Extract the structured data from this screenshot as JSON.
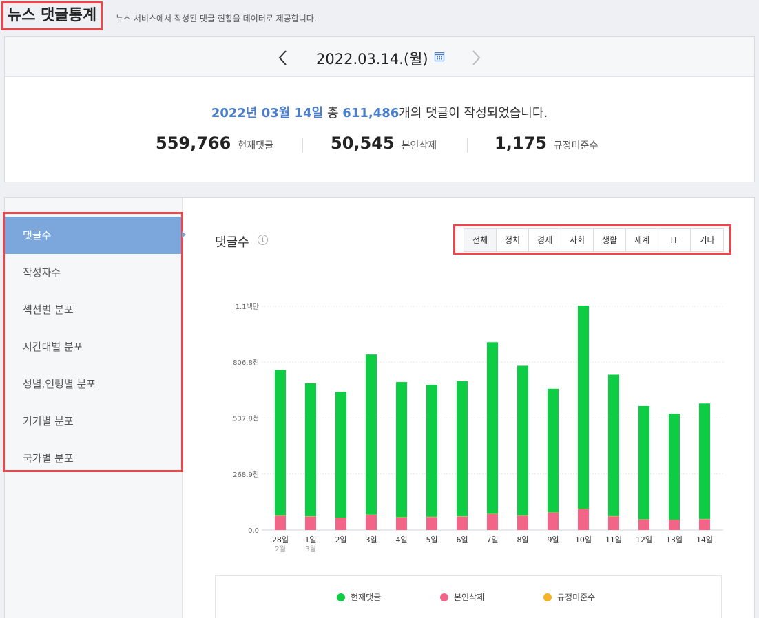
{
  "header": {
    "title": "뉴스 댓글통계",
    "description": "뉴스 서비스에서 작성된 댓글 현황을 데이터로 제공합니다."
  },
  "date_bar": {
    "date": "2022.03.14.(월)",
    "prev_icon": "chevron-left-icon",
    "next_icon": "chevron-right-icon",
    "calendar_icon": "calendar-icon"
  },
  "summary": {
    "date_text": "2022년 03월 14일",
    "total_prefix": "총",
    "total_count": "611,486",
    "suffix": "개의 댓글이 작성되었습니다.",
    "stats": [
      {
        "value": "559,766",
        "label": "현재댓글"
      },
      {
        "value": "50,545",
        "label": "본인삭제"
      },
      {
        "value": "1,175",
        "label": "규정미준수"
      }
    ]
  },
  "sidebar": {
    "items": [
      {
        "label": "댓글수",
        "active": true
      },
      {
        "label": "작성자수",
        "active": false
      },
      {
        "label": "섹션별 분포",
        "active": false
      },
      {
        "label": "시간대별 분포",
        "active": false
      },
      {
        "label": "성별,연령별 분포",
        "active": false
      },
      {
        "label": "기기별 분포",
        "active": false
      },
      {
        "label": "국가별 분포",
        "active": false
      }
    ]
  },
  "chart_panel": {
    "title": "댓글수",
    "info_icon": "info-icon",
    "tabs": [
      {
        "label": "전체",
        "active": true
      },
      {
        "label": "정치",
        "active": false
      },
      {
        "label": "경제",
        "active": false
      },
      {
        "label": "사회",
        "active": false
      },
      {
        "label": "생활",
        "active": false
      },
      {
        "label": "세계",
        "active": false
      },
      {
        "label": "IT",
        "active": false
      },
      {
        "label": "기타",
        "active": false
      }
    ]
  },
  "colors": {
    "current": "#0ecd45",
    "deleted": "#f26589",
    "violation": "#f5b325",
    "accent": "#4a7ec9",
    "highlight_border": "#e8474b"
  },
  "chart_data": {
    "type": "bar",
    "stacked": true,
    "categories": [
      "28일",
      "1일",
      "2일",
      "3일",
      "4일",
      "5일",
      "6일",
      "7일",
      "8일",
      "9일",
      "10일",
      "11일",
      "12일",
      "13일",
      "14일"
    ],
    "sublabels": [
      "2월",
      "3월",
      "",
      "",
      "",
      "",
      "",
      "",
      "",
      "",
      "",
      "",
      "",
      "",
      ""
    ],
    "y_ticks": [
      {
        "value": 0,
        "label": "0.0"
      },
      {
        "value": 268900,
        "label": "268.9천"
      },
      {
        "value": 537800,
        "label": "537.8천"
      },
      {
        "value": 806800,
        "label": "806.8천"
      },
      {
        "value": 1075700,
        "label": "1.1백만"
      }
    ],
    "ylim": [
      0,
      1075700
    ],
    "series": [
      {
        "name": "현재댓글",
        "color": "#0ecd45",
        "values": [
          700000,
          640000,
          605000,
          770000,
          650000,
          635000,
          650000,
          825000,
          720000,
          595000,
          977000,
          680000,
          545000,
          510000,
          555000
        ]
      },
      {
        "name": "본인삭제",
        "color": "#f26589",
        "values": [
          68000,
          64000,
          58000,
          72000,
          60000,
          62000,
          64000,
          76000,
          68000,
          83000,
          100000,
          65000,
          50000,
          48000,
          52000
        ]
      },
      {
        "name": "규정미준수",
        "color": "#f5b325",
        "values": [
          1500,
          1400,
          1300,
          1600,
          1400,
          1300,
          1400,
          1700,
          1500,
          1200,
          2000,
          1400,
          1100,
          1100,
          1175
        ]
      }
    ],
    "grid": true,
    "legend_position": "bottom"
  }
}
